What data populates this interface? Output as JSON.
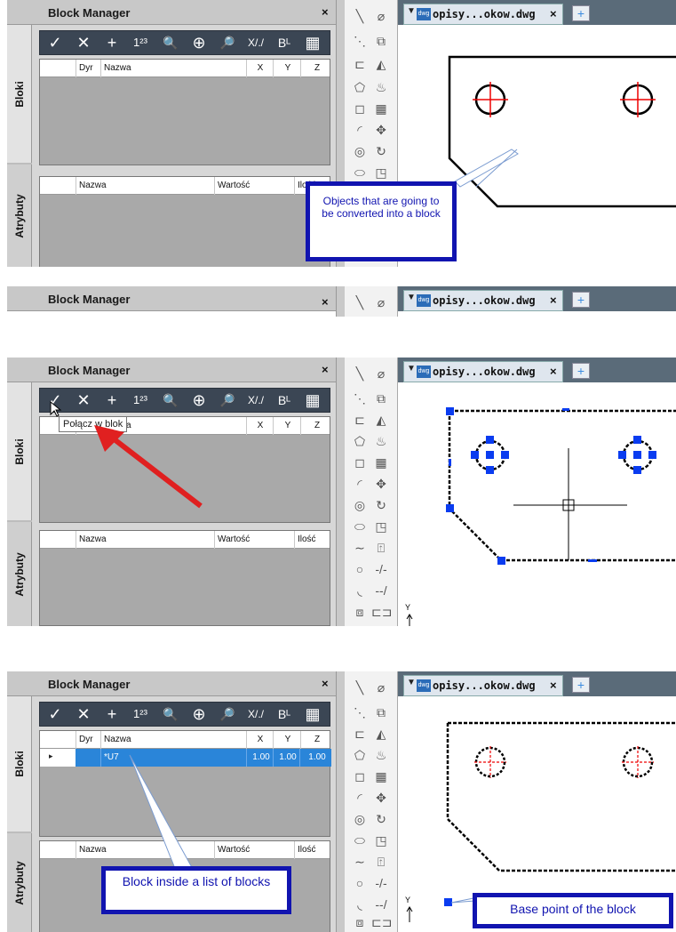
{
  "panel_title": "Block Manager",
  "close_icon": "×",
  "tabs": {
    "blocks": "Bloki",
    "attributes": "Atrybuty"
  },
  "toolbar": {
    "check": "✓",
    "cancel": "✕",
    "add": "+",
    "number": "1²³",
    "search": "🔍",
    "explode": "⊕",
    "zoom": "🔎",
    "xscale": "X/./",
    "blabel": "Bᴸ",
    "grid": "▦"
  },
  "blocks_table": {
    "columns": [
      "Dyr",
      "Nazwa",
      "X",
      "Y",
      "Z"
    ]
  },
  "attributes_table": {
    "columns": [
      "Nazwa",
      "Wartość",
      "Ilość"
    ]
  },
  "drawing_tab": {
    "name": "opisy...okow.dwg",
    "close": "×",
    "icon": "dwg-icon",
    "new_tab": "+"
  },
  "step1": {
    "callout": "Objects that are going to be converted into a block"
  },
  "step2": {
    "tooltip": "Połącz w blok",
    "axis_label": "Y"
  },
  "step3": {
    "row": {
      "arrow": "▸",
      "name": "*U7",
      "x": "1.00",
      "y": "1.00",
      "z": "1.00"
    },
    "callout_block": "Block inside a list of blocks",
    "callout_base": "Base point of the block",
    "axis_label": "Y"
  },
  "colors": {
    "callout_border": "#1114b0",
    "selection": "#2a85d9",
    "grip": "#0a3cf0",
    "arrow": "#e02020"
  }
}
